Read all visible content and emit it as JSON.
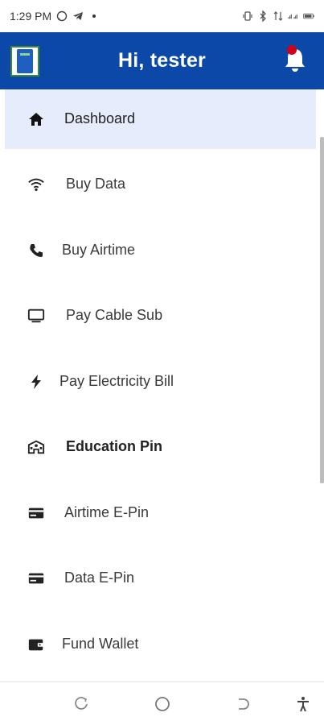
{
  "status_bar": {
    "time": "1:29 PM",
    "icons_left": [
      "whatsapp-icon",
      "telegram-icon",
      "dot"
    ],
    "icons_right": [
      "vibrate-icon",
      "bluetooth-icon",
      "data-arrows-icon",
      "signal-icon",
      "battery-icon"
    ]
  },
  "app_bar": {
    "title": "Hi, tester",
    "background": "#0b48a8",
    "notification_dot_color": "#d0021b"
  },
  "menu": {
    "items": [
      {
        "label": "Dashboard",
        "icon": "home-icon",
        "active": true
      },
      {
        "label": "Buy Data",
        "icon": "wifi-icon"
      },
      {
        "label": "Buy Airtime",
        "icon": "phone-icon"
      },
      {
        "label": "Pay Cable Sub",
        "icon": "monitor-icon"
      },
      {
        "label": "Pay Electricity Bill",
        "icon": "bolt-icon"
      },
      {
        "label": "Education Pin",
        "icon": "school-icon"
      },
      {
        "label": "Airtime E-Pin",
        "icon": "card-icon"
      },
      {
        "label": "Data E-Pin",
        "icon": "card-icon"
      },
      {
        "label": "Fund Wallet",
        "icon": "wallet-icon"
      }
    ],
    "active_background": "#e6ecfb"
  },
  "nav_bar": {
    "buttons": [
      "recents-icon",
      "home-circle-icon",
      "back-icon",
      "accessibility-icon"
    ]
  }
}
